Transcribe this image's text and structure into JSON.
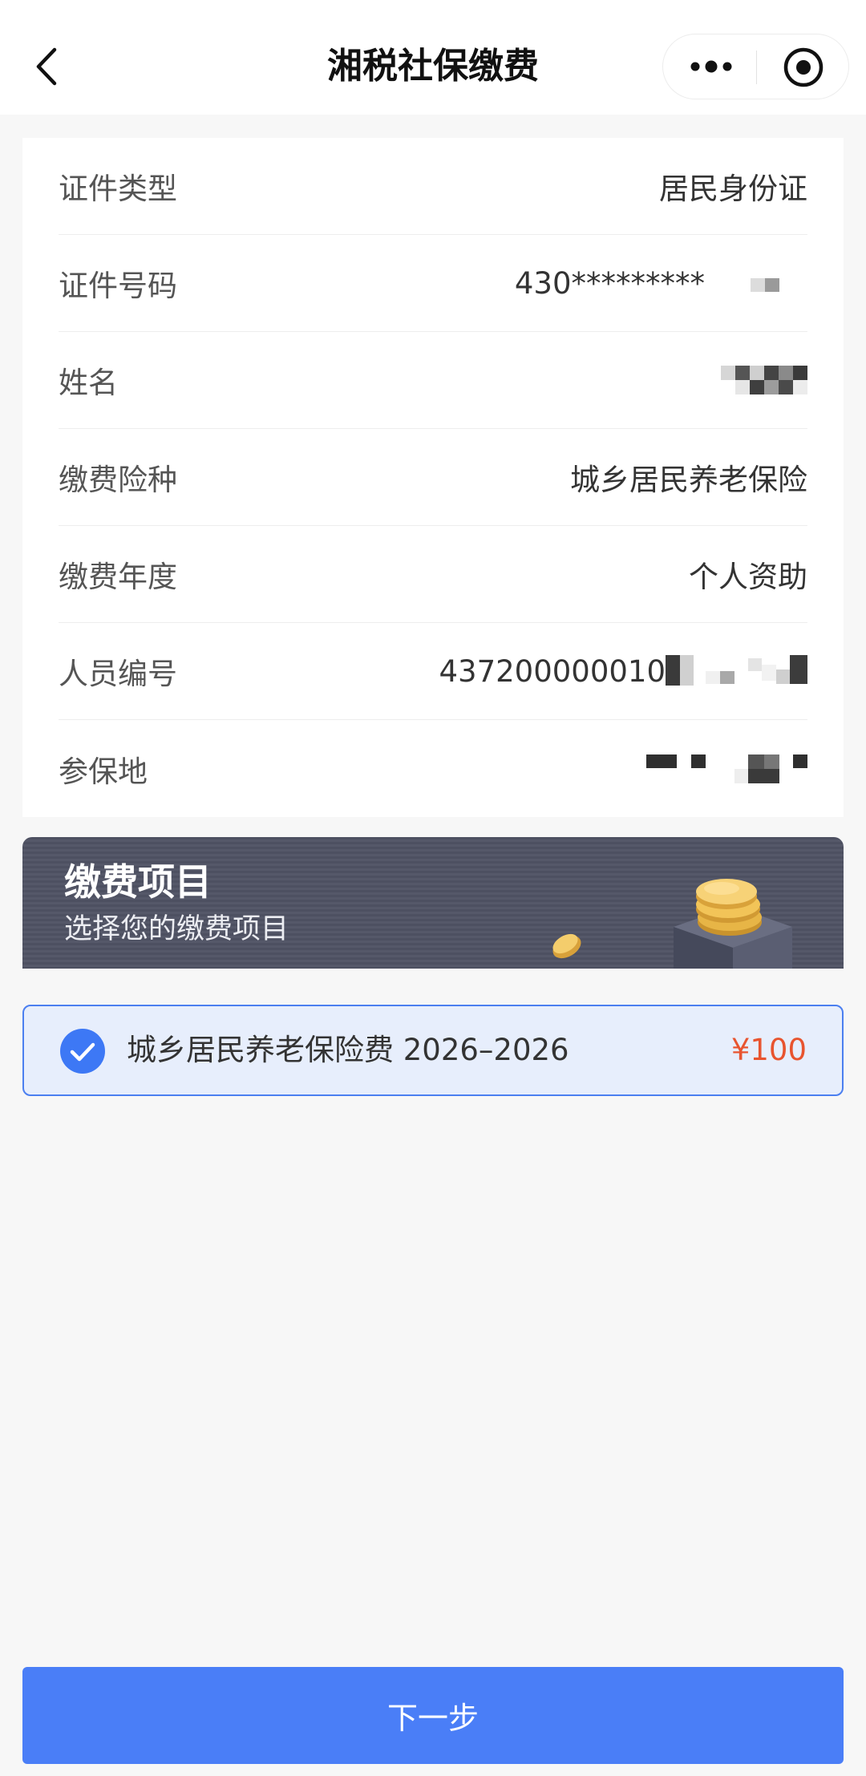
{
  "header": {
    "title": "湘税社保缴费",
    "back_icon": "chevron-left-icon",
    "more_icon": "more-dots-icon",
    "close_icon": "target-icon"
  },
  "info": {
    "rows": [
      {
        "label": "证件类型",
        "value": "居民身份证"
      },
      {
        "label": "证件号码",
        "value": "430*********",
        "redacted": true
      },
      {
        "label": "姓名",
        "redacted": true
      },
      {
        "label": "缴费险种",
        "value": "城乡居民养老保险"
      },
      {
        "label": "缴费年度",
        "value": "个人资助"
      },
      {
        "label": "人员编号",
        "value": "437200000010",
        "redacted": true
      },
      {
        "label": "参保地",
        "redacted": true
      }
    ]
  },
  "banner": {
    "title": "缴费项目",
    "subtitle": "选择您的缴费项目",
    "illustration": "coins-on-cube-icon"
  },
  "payment_item": {
    "label": "城乡居民养老保险费 2026–2026",
    "price": "¥100",
    "selected": true,
    "check_icon": "check-circle-icon"
  },
  "footer": {
    "next_label": "下一步"
  },
  "colors": {
    "accent": "#4a7ef7",
    "price": "#e8542f",
    "banner": "#4e5160",
    "selected_bg": "#e7eefc"
  }
}
